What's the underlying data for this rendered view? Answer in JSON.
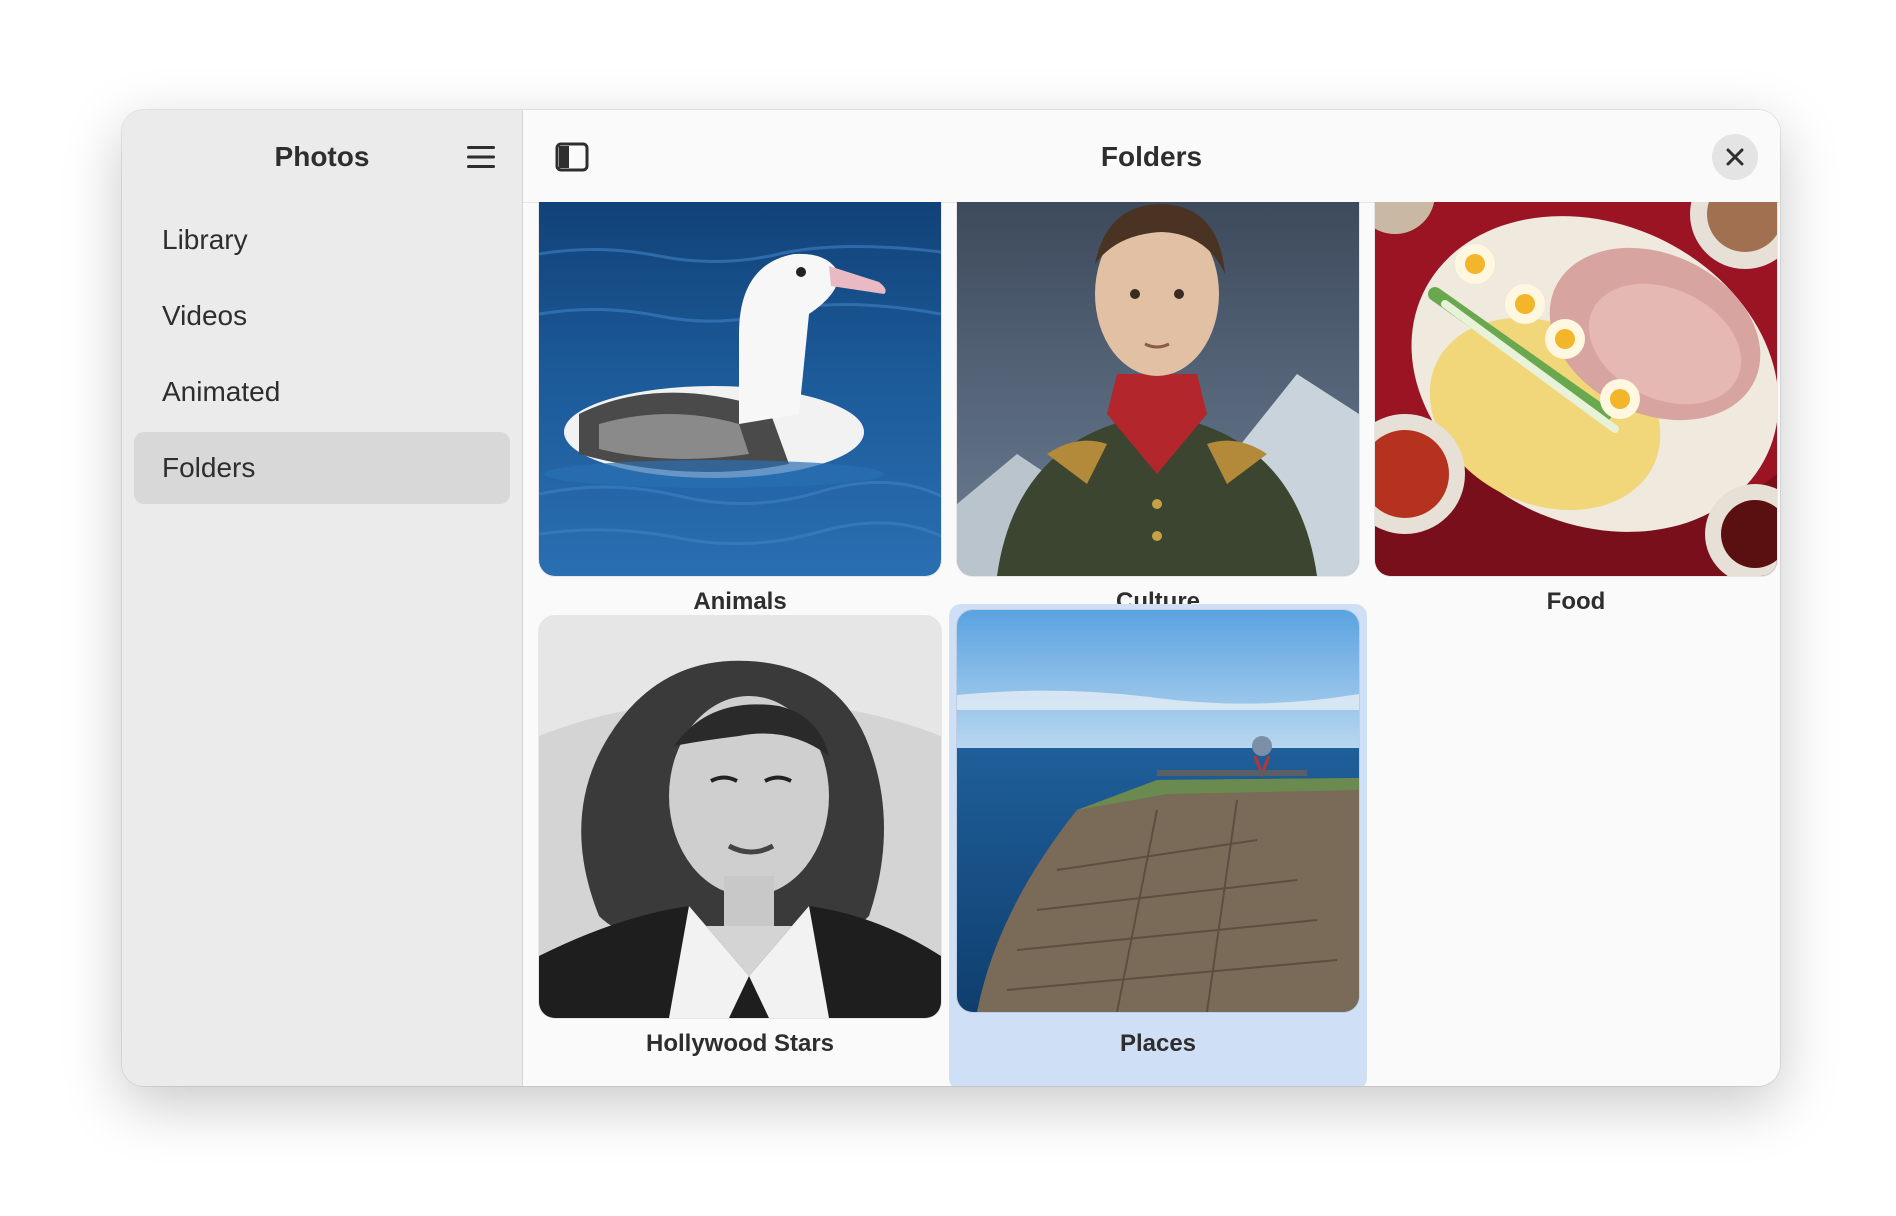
{
  "sidebar": {
    "title": "Photos",
    "menu_icon": "hamburger-menu-icon",
    "items": [
      {
        "label": "Library"
      },
      {
        "label": "Videos"
      },
      {
        "label": "Animated"
      },
      {
        "label": "Folders",
        "selected": true
      }
    ]
  },
  "header": {
    "title": "Folders",
    "toggle_icon": "sidebar-toggle-icon",
    "close_icon": "close-icon"
  },
  "folders": [
    {
      "label": "Animals",
      "thumbnail": "albatross-on-water"
    },
    {
      "label": "Culture",
      "thumbnail": "portrait-painting-soldier"
    },
    {
      "label": "Food",
      "thumbnail": "meat-and-cheese-platter"
    },
    {
      "label": "Hollywood Stars",
      "thumbnail": "black-and-white-portrait"
    },
    {
      "label": "Places",
      "thumbnail": "sea-cliff-landscape",
      "selected": true
    }
  ],
  "colors": {
    "sidebar_bg": "#ebebeb",
    "selected_nav": "#d8d8d8",
    "selected_tile": "#cfdff5",
    "text": "#2e2e2e"
  }
}
